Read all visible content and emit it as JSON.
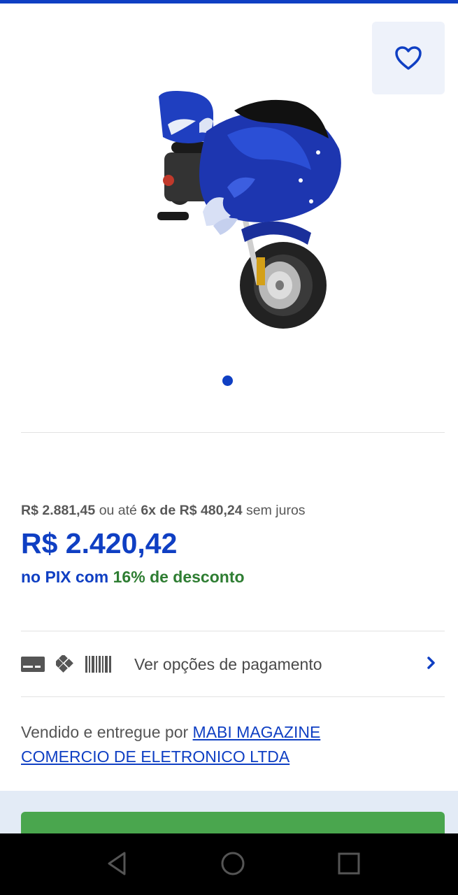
{
  "icons": {
    "favorite": "heart-icon",
    "card": "credit-card-icon",
    "pix": "pix-icon",
    "boleto": "barcode-icon",
    "chevron": "chevron-right-icon",
    "nav_back": "back-triangle-icon",
    "nav_home": "home-circle-icon",
    "nav_recents": "recents-square-icon"
  },
  "colors": {
    "brand_blue": "#0f3fc3",
    "discount_green": "#2e7d32",
    "buy_button_green": "#4aa64e"
  },
  "gallery": {
    "image_label": "pocket-bike-blue-flames",
    "active_page": 1,
    "total_pages": 1
  },
  "price": {
    "original": "R$ 2.881,45",
    "installment_prefix": "ou até",
    "installment_bold": "6x de R$ 480,24",
    "installment_suffix": "sem juros",
    "pix_price": "R$ 2.420,42",
    "pix_prefix": "no PIX com",
    "pix_discount": "16% de desconto"
  },
  "payment": {
    "label": "Ver opções de pagamento"
  },
  "seller": {
    "prefix": "Vendido e entregue por",
    "name": "MABI MAGAZINE COMERCIO DE ELETRONICO LTDA"
  }
}
